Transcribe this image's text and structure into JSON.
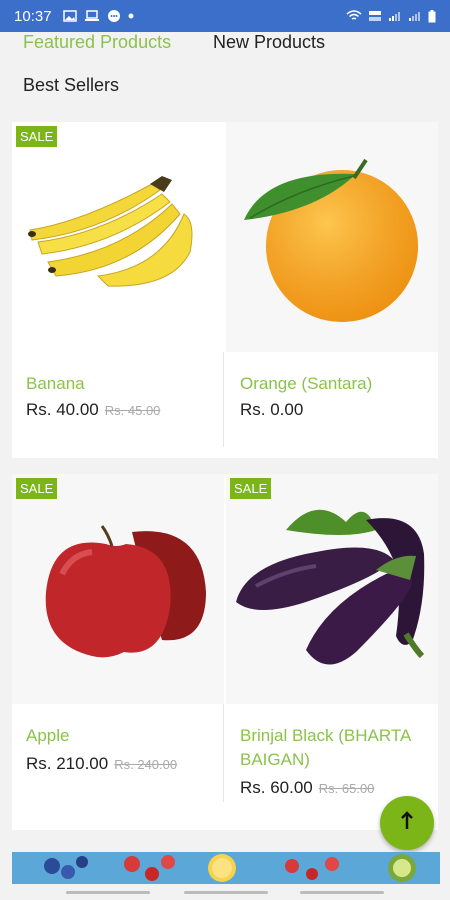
{
  "status_bar": {
    "time": "10:37"
  },
  "tabs": {
    "featured": "Featured Products",
    "new": "New Products",
    "best": "Best Sellers"
  },
  "colors": {
    "accent": "#8bc34a",
    "badge": "#7cb518",
    "status_bar": "#3b6fc9"
  },
  "products": [
    {
      "name": "Banana",
      "price": "Rs. 40.00",
      "old_price": "Rs. 45.00",
      "badge": "SALE"
    },
    {
      "name": "Orange (Santara)",
      "price": "Rs. 0.00"
    },
    {
      "name": "Apple",
      "price": "Rs. 210.00",
      "old_price": "Rs. 240.00",
      "badge": "SALE"
    },
    {
      "name": "Brinjal Black (BHARTA BAIGAN)",
      "price": "Rs. 60.00",
      "old_price": "Rs. 65.00",
      "badge": "SALE"
    }
  ],
  "fab": {
    "icon": "arrow-up-icon"
  }
}
